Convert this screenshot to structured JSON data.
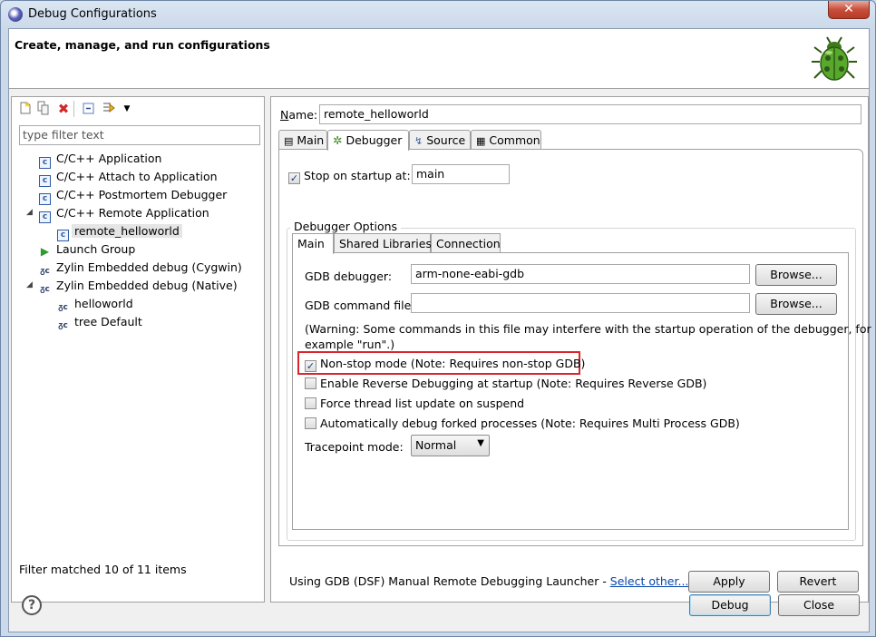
{
  "window": {
    "title": "Debug Configurations",
    "close_label": "✕"
  },
  "banner": {
    "title": "Create, manage, and run configurations"
  },
  "left": {
    "filter_placeholder": "type filter text",
    "tree": [
      {
        "label": "C/C++ Application"
      },
      {
        "label": "C/C++ Attach to Application"
      },
      {
        "label": "C/C++ Postmortem Debugger"
      },
      {
        "label": "C/C++ Remote Application"
      },
      {
        "label": "remote_helloworld"
      },
      {
        "label": "Launch Group"
      },
      {
        "label": "Zylin Embedded debug (Cygwin)"
      },
      {
        "label": "Zylin Embedded debug (Native)"
      },
      {
        "label": "helloworld"
      },
      {
        "label": "tree Default"
      }
    ],
    "footer": "Filter matched 10 of 11 items"
  },
  "right": {
    "name_label": "Name:",
    "name_value": "remote_helloworld",
    "tabs": [
      "Main",
      "Debugger",
      "Source",
      "Common"
    ],
    "stop_label": "Stop on startup at:",
    "stop_value": "main",
    "group_title": "Debugger Options",
    "inner_tabs": [
      "Main",
      "Shared Libraries",
      "Connection"
    ],
    "gdb_debugger_label": "GDB debugger:",
    "gdb_debugger_value": "arm-none-eabi-gdb",
    "gdb_cmd_label": "GDB command file:",
    "gdb_cmd_value": "",
    "browse_label": "Browse...",
    "warning_line1": "(Warning: Some commands in this file may interfere with the startup operation of the debugger, for",
    "warning_line2": "example \"run\".)",
    "opts": [
      {
        "label": "Non-stop mode (Note: Requires non-stop GDB)",
        "checked": true
      },
      {
        "label": "Enable Reverse Debugging at startup (Note: Requires Reverse GDB)",
        "checked": false
      },
      {
        "label": "Force thread list update on suspend",
        "checked": false
      },
      {
        "label": "Automatically debug forked processes (Note: Requires Multi Process GDB)",
        "checked": false
      }
    ],
    "tracepoint_label": "Tracepoint mode:",
    "tracepoint_value": "Normal",
    "launcher_text": "Using GDB (DSF) Manual Remote Debugging Launcher - ",
    "select_other": "Select other...",
    "apply_label": "Apply",
    "revert_label": "Revert"
  },
  "bottom": {
    "help_label": "?",
    "debug_label": "Debug",
    "close_label": "Close"
  }
}
